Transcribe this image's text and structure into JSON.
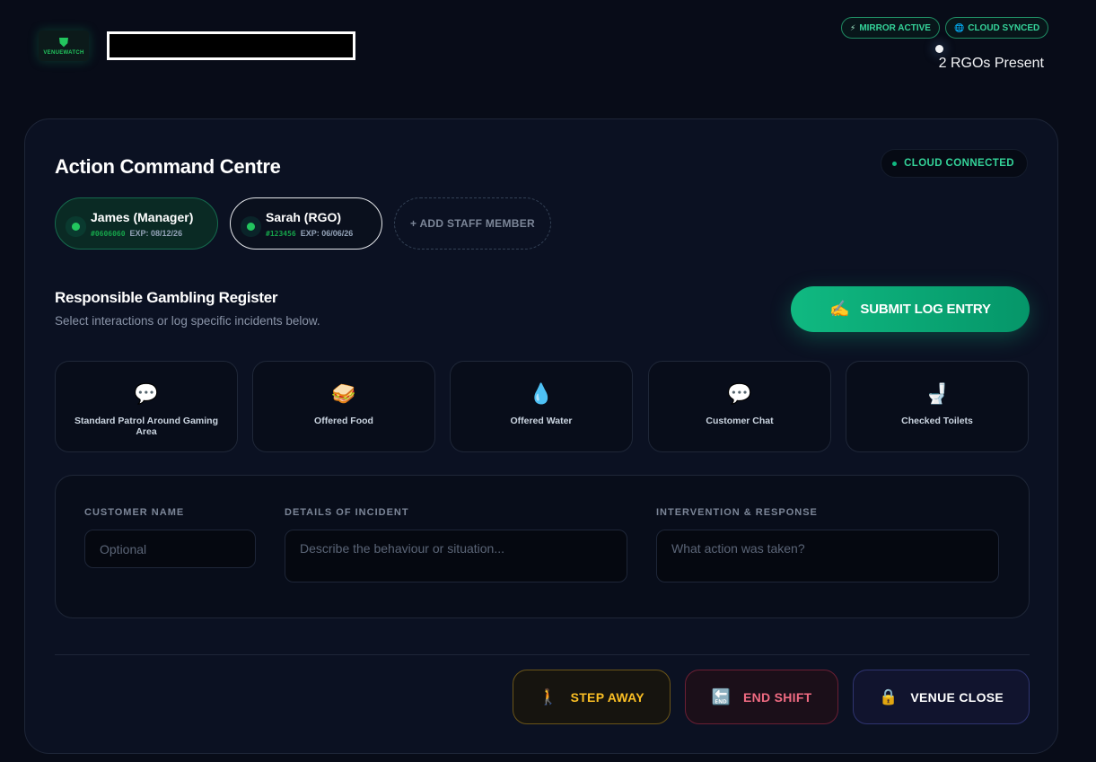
{
  "header": {
    "logo_text": "VENUEWATCH",
    "badges": [
      {
        "icon": "⚡",
        "label": "MIRROR ACTIVE"
      },
      {
        "icon": "🌐",
        "label": "CLOUD SYNCED"
      }
    ],
    "rgo_count": "2 RGOs Present"
  },
  "panel": {
    "title": "Action Command Centre",
    "cloud_status": "CLOUD CONNECTED",
    "staff": [
      {
        "name": "James (Manager)",
        "id": "#0606060",
        "expiry": "EXP: 08/12/26"
      },
      {
        "name": "Sarah (RGO)",
        "id": "#123456",
        "expiry": "EXP: 06/06/26"
      }
    ],
    "add_staff_label": "+ ADD STAFF MEMBER",
    "register": {
      "title": "Responsible Gambling Register",
      "subtitle": "Select interactions or log specific incidents below.",
      "submit_label": "SUBMIT LOG ENTRY",
      "submit_icon": "✍️"
    },
    "quick_actions": [
      {
        "icon": "💬",
        "label": "Standard Patrol Around Gaming Area"
      },
      {
        "icon": "🥪",
        "label": "Offered Food"
      },
      {
        "icon": "💧",
        "label": "Offered Water"
      },
      {
        "icon": "💬",
        "label": "Customer Chat"
      },
      {
        "icon": "🚽",
        "label": "Checked Toilets"
      }
    ],
    "form": {
      "customer_name_label": "CUSTOMER NAME",
      "customer_name_placeholder": "Optional",
      "details_label": "DETAILS OF INCIDENT",
      "details_placeholder": "Describe the behaviour or situation...",
      "intervention_label": "INTERVENTION & RESPONSE",
      "intervention_placeholder": "What action was taken?"
    },
    "actions": [
      {
        "icon": "🚶",
        "label": "STEP AWAY"
      },
      {
        "icon": "🔚",
        "label": "END SHIFT"
      },
      {
        "icon": "🔒",
        "label": "VENUE CLOSE"
      }
    ]
  }
}
